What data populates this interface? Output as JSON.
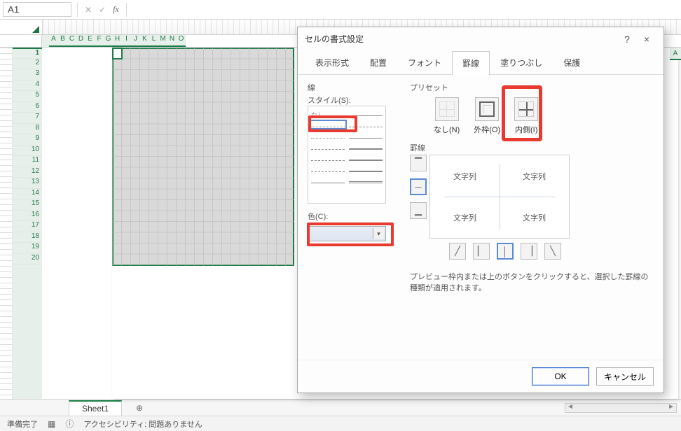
{
  "formula_bar": {
    "cell_ref": "A1",
    "cancel": "✕",
    "confirm": "✓",
    "fx": "fx"
  },
  "columns": [
    "A",
    "B",
    "C",
    "D",
    "E",
    "F",
    "G",
    "H",
    "I",
    "J",
    "K",
    "L",
    "M",
    "N",
    "O"
  ],
  "right_edge_col": "A",
  "rows": [
    "1",
    "2",
    "3",
    "4",
    "5",
    "6",
    "7",
    "8",
    "9",
    "10",
    "11",
    "12",
    "13",
    "14",
    "15",
    "16",
    "17",
    "18",
    "19",
    "20"
  ],
  "sheet_tabs": {
    "active": "Sheet1",
    "add": "⊕"
  },
  "status": {
    "state": "準備完了",
    "acc_label": "アクセシビリティ: 問題ありません"
  },
  "dialog": {
    "title": "セルの書式設定",
    "help": "?",
    "close": "×",
    "tabs": [
      "表示形式",
      "配置",
      "フォント",
      "罫線",
      "塗りつぶし",
      "保護"
    ],
    "active_tab": "罫線",
    "line_group": "線",
    "style_label": "スタイル(S):",
    "style_none": "なし",
    "color_label": "色(C):",
    "preset_group": "プリセット",
    "presets": {
      "none": "なし(N)",
      "outline": "外枠(O)",
      "inside": "内側(I)"
    },
    "border_group": "罫線",
    "preview_text": "文字列",
    "hint": "プレビュー枠内または上のボタンをクリックすると、選択した罫線の種類が適用されます。",
    "ok": "OK",
    "cancel": "キャンセル"
  }
}
